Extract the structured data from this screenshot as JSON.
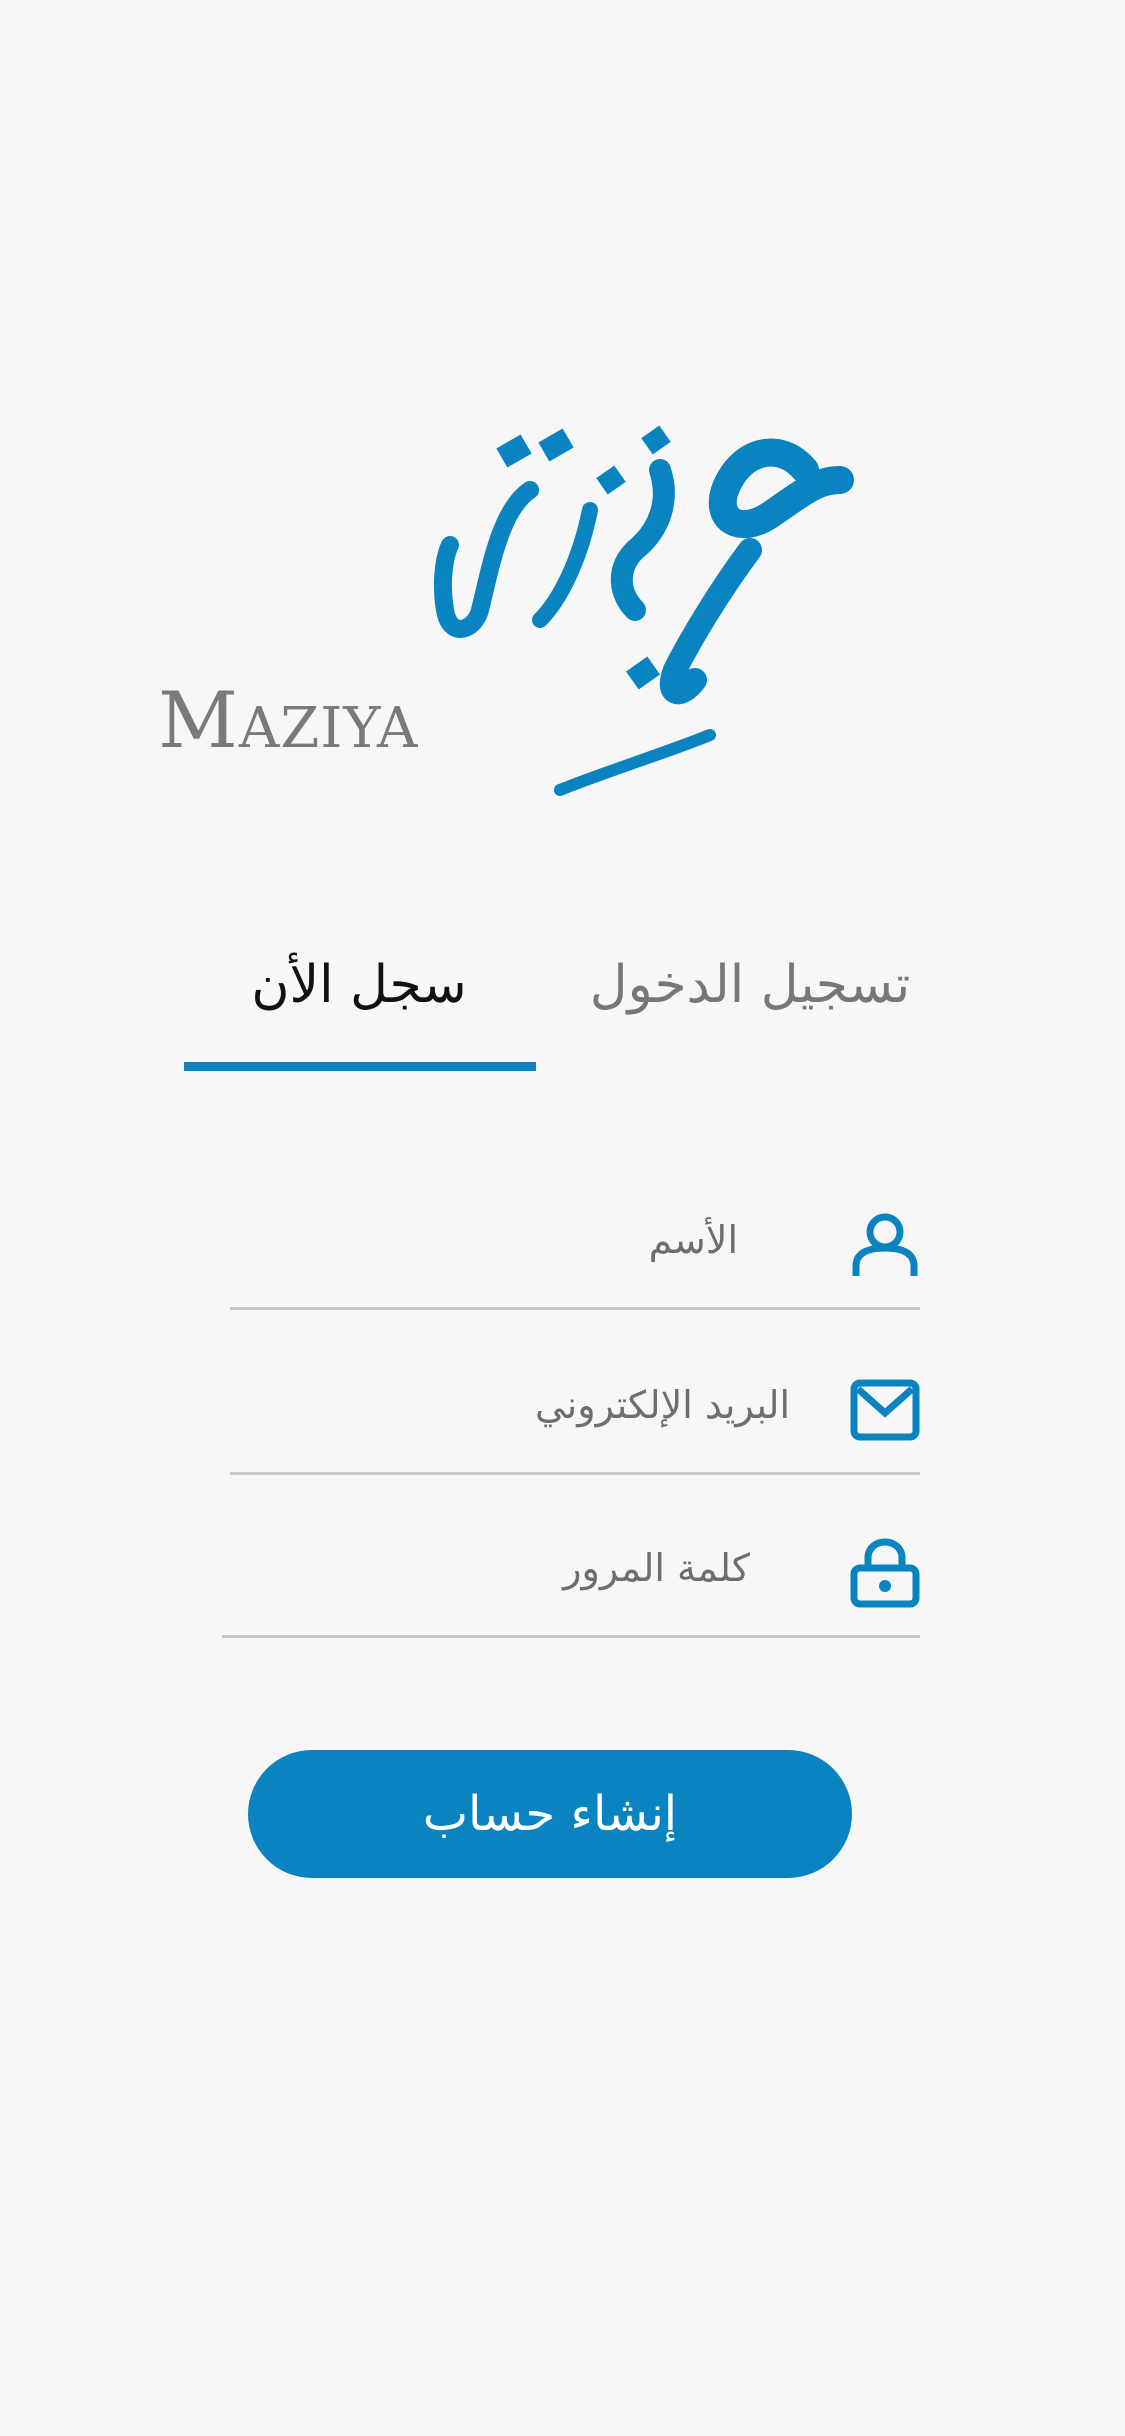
{
  "brand": {
    "arabic_logo": "مزية",
    "latin_first": "M",
    "latin_rest": "AZIYA",
    "accent_color": "#0a84c1"
  },
  "tabs": {
    "signup_label": "سجل الأن",
    "login_label": "تسجيل الدخول",
    "active": "signup"
  },
  "form": {
    "name_placeholder": "الأسم",
    "email_placeholder": "البريد الإلكتروني",
    "password_placeholder": "كلمة المرور",
    "icons": {
      "name": "user-icon",
      "email": "mail-icon",
      "password": "lock-icon"
    }
  },
  "actions": {
    "create_account_label": "إنشاء حساب"
  }
}
